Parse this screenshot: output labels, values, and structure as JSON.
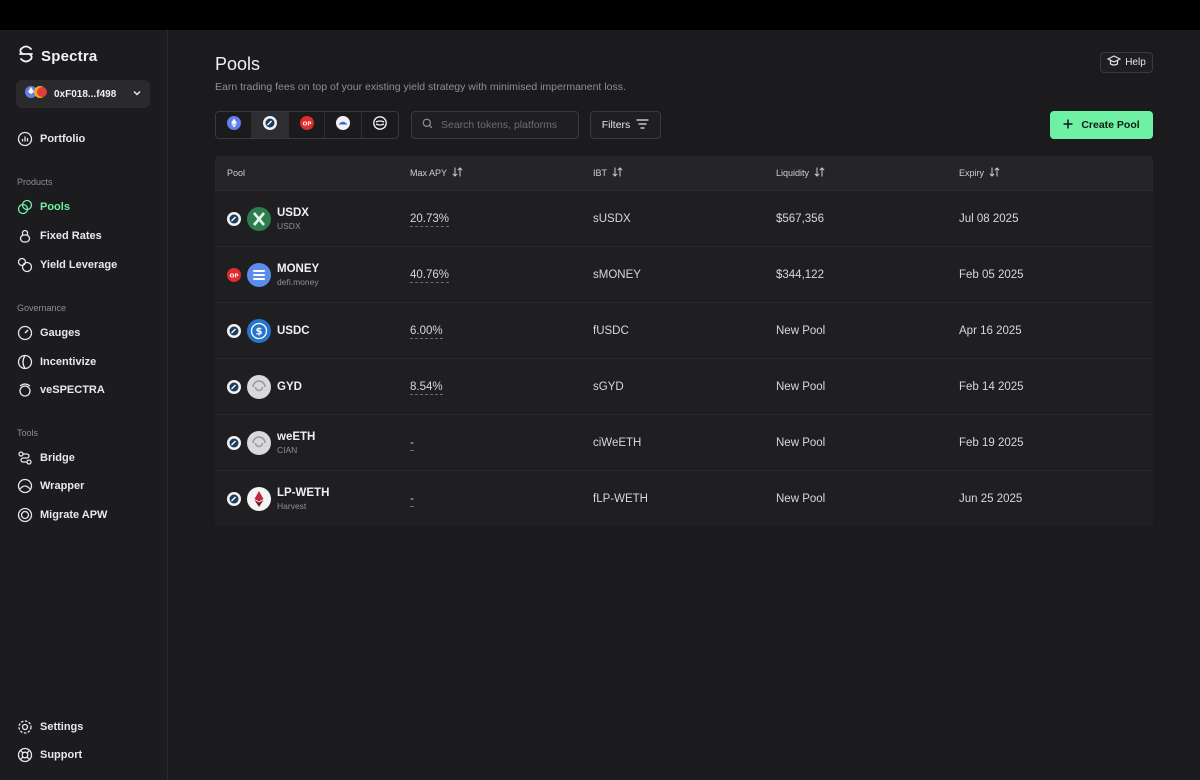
{
  "brand": {
    "name": "Spectra"
  },
  "wallet": {
    "address": "0xF018...f498"
  },
  "nav": {
    "portfolio": "Portfolio",
    "products_title": "Products",
    "products": [
      "Pools",
      "Fixed Rates",
      "Yield Leverage"
    ],
    "governance_title": "Governance",
    "governance": [
      "Gauges",
      "Incentivize",
      "veSPECTRA"
    ],
    "tools_title": "Tools",
    "tools": [
      "Bridge",
      "Wrapper",
      "Migrate APW"
    ],
    "settings": "Settings",
    "support": "Support",
    "active": "Pools"
  },
  "header": {
    "title": "Pools",
    "subtitle": "Earn trading fees on top of your existing yield strategy with minimised impermanent loss.",
    "help_label": "Help"
  },
  "toolbar": {
    "chains": [
      "ethereum",
      "base",
      "op",
      "arbitrum",
      "sonic"
    ],
    "selected_chain": "base",
    "search_placeholder": "Search tokens, platforms",
    "filters_label": "Filters",
    "create_label": "Create Pool"
  },
  "table": {
    "headers": [
      "Pool",
      "Max APY",
      "IBT",
      "Liquidity",
      "Expiry"
    ],
    "rows": [
      {
        "chain": "base",
        "icon": "usdx-icon",
        "name": "USDX",
        "sub": "USDX",
        "apy": "20.73%",
        "ibt": "sUSDX",
        "liquidity": "$567,356",
        "expiry": "Jul 08 2025"
      },
      {
        "chain": "op",
        "icon": "money-icon",
        "name": "MONEY",
        "sub": "defi.money",
        "apy": "40.76%",
        "ibt": "sMONEY",
        "liquidity": "$344,122",
        "expiry": "Feb 05 2025"
      },
      {
        "chain": "base",
        "icon": "usdc-icon",
        "name": "USDC",
        "sub": "",
        "apy": "6.00%",
        "ibt": "fUSDC",
        "liquidity": "New Pool",
        "expiry": "Apr 16 2025"
      },
      {
        "chain": "base",
        "icon": "gyd-icon",
        "name": "GYD",
        "sub": "",
        "apy": "8.54%",
        "ibt": "sGYD",
        "liquidity": "New Pool",
        "expiry": "Feb 14 2025"
      },
      {
        "chain": "base",
        "icon": "weeth-icon",
        "name": "weETH",
        "sub": "CIAN",
        "apy": "-",
        "ibt": "ciWeETH",
        "liquidity": "New Pool",
        "expiry": "Feb 19 2025"
      },
      {
        "chain": "base",
        "icon": "eth-icon",
        "name": "LP-WETH",
        "sub": "Harvest",
        "apy": "-",
        "ibt": "fLP-WETH",
        "liquidity": "New Pool",
        "expiry": "Jun 25 2025"
      }
    ]
  },
  "colors": {
    "accent": "#6ef0a5",
    "bg": "#1b1b1d",
    "panel": "#1f1f22"
  }
}
